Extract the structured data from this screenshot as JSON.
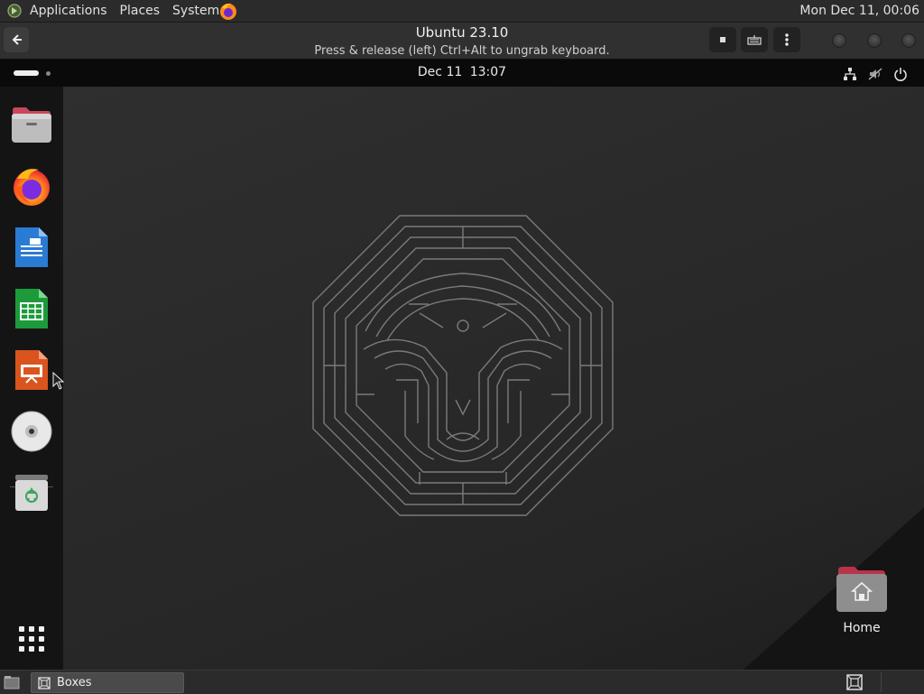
{
  "host_panel": {
    "menus": [
      "Applications",
      "Places",
      "System"
    ],
    "clock": "Mon Dec 11, 00:06"
  },
  "boxes_header": {
    "title": "Ubuntu 23.10",
    "subtitle": "Press & release (left) Ctrl+Alt to ungrab keyboard."
  },
  "guest_bar": {
    "date": "Dec 11",
    "time": "13:07"
  },
  "dock": {
    "items": [
      {
        "name": "files-icon"
      },
      {
        "name": "firefox-icon"
      },
      {
        "name": "libreoffice-writer-icon"
      },
      {
        "name": "libreoffice-calc-icon"
      },
      {
        "name": "libreoffice-impress-icon"
      },
      {
        "name": "disc-icon"
      },
      {
        "name": "trash-icon"
      }
    ]
  },
  "desktop": {
    "home_label": "Home"
  },
  "taskbar": {
    "window_label": "Boxes"
  },
  "colors": {
    "host_panel": "#2b2b2b",
    "guest_bar": "#0a0a0a",
    "dock": "#141414",
    "firefox_orange": "#ff7a1a",
    "writer_blue": "#2a7bd3",
    "calc_green": "#1d9b3a",
    "impress_orange": "#d9541e"
  }
}
